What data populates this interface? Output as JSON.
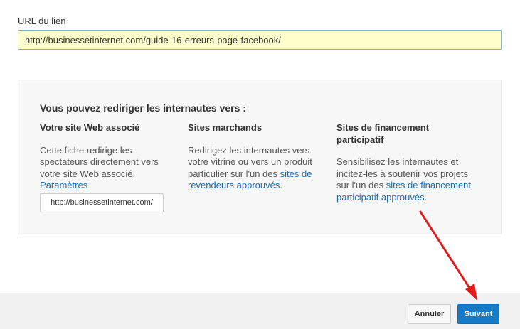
{
  "url_section": {
    "label": "URL du lien",
    "value": "http://businessetinternet.com/guide-16-erreurs-page-facebook/"
  },
  "panel": {
    "title": "Vous pouvez rediriger les internautes vers :",
    "columns": [
      {
        "heading": "Votre site Web associé",
        "text": "Cette fiche redirige les spectateurs directement vers votre site Web associé.",
        "link": "Paramètres",
        "site_url": "http://businessetinternet.com/"
      },
      {
        "heading": "Sites marchands",
        "text": "Redirigez les internautes vers votre vitrine ou vers un produit particulier sur l'un des",
        "link": "sites de revendeurs approuvés",
        "suffix": "."
      },
      {
        "heading": "Sites de financement participatif",
        "text": "Sensibilisez les internautes et incitez-les à soutenir vos projets sur l'un des",
        "link": "sites de financement participatif approuvés",
        "suffix": "."
      }
    ]
  },
  "footer": {
    "cancel_label": "Annuler",
    "next_label": "Suivant"
  },
  "annotation": {
    "arrow_color": "#e11b1b",
    "icon": "red-arrow-icon"
  },
  "colors": {
    "accent": "#167ac6",
    "link": "#1a6fb7",
    "input_bg": "#ffffcc"
  }
}
